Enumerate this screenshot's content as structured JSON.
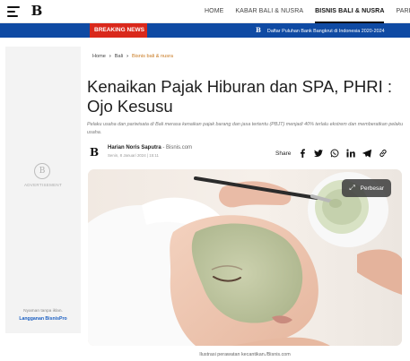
{
  "header": {
    "logo_text": "B",
    "nav": [
      {
        "label": "HOME",
        "active": false
      },
      {
        "label": "KABAR BALI & NUSRA",
        "active": false
      },
      {
        "label": "BISNIS BALI & NUSRA",
        "active": true
      },
      {
        "label": "PARIW",
        "active": false
      }
    ]
  },
  "breaking": {
    "label": "BREAKING NEWS",
    "logo_text": "B",
    "headline": "Daftar Puluhan Bank Bangkrut di Indonesia 2020-2024"
  },
  "sidebar_ad": {
    "logo_text": "B",
    "label": "ADVERTISEMENT",
    "note": "Nyaman tanpa iklan.",
    "link": "Langganan BisnisPro"
  },
  "breadcrumb": {
    "home": "Home",
    "level2": "Bali",
    "current": "Bisnis bali & nusra"
  },
  "article": {
    "title": "Kenaikan Pajak Hiburan dan SPA, PHRI : Ojo Kesusu",
    "lead": "Pelaku usaha dan pariwisata di Bali merasa kenaikan pajak barang dan jasa tertentu (PBJT) menjadi 40% terlalu ekstrem dan memberatkan pelaku usaha.",
    "author": "Harian Noris Saputra",
    "source": "- Bisnis.com",
    "date": "Senin, 8 Januari 2024 | 15:11",
    "author_logo": "B",
    "share_label": "Share",
    "zoom_label": "Perbesar",
    "caption": "Ilustrasi perawatan kecantikan./Bisnis.com"
  },
  "colors": {
    "breaking_bar": "#0f4aa3",
    "breaking_label": "#d9281b",
    "breadcrumb_current": "#c8781e",
    "link": "#1b5fc2"
  },
  "icons": [
    "menu-icon",
    "facebook-icon",
    "twitter-icon",
    "whatsapp-icon",
    "linkedin-icon",
    "telegram-icon",
    "copy-link-icon",
    "expand-icon"
  ]
}
